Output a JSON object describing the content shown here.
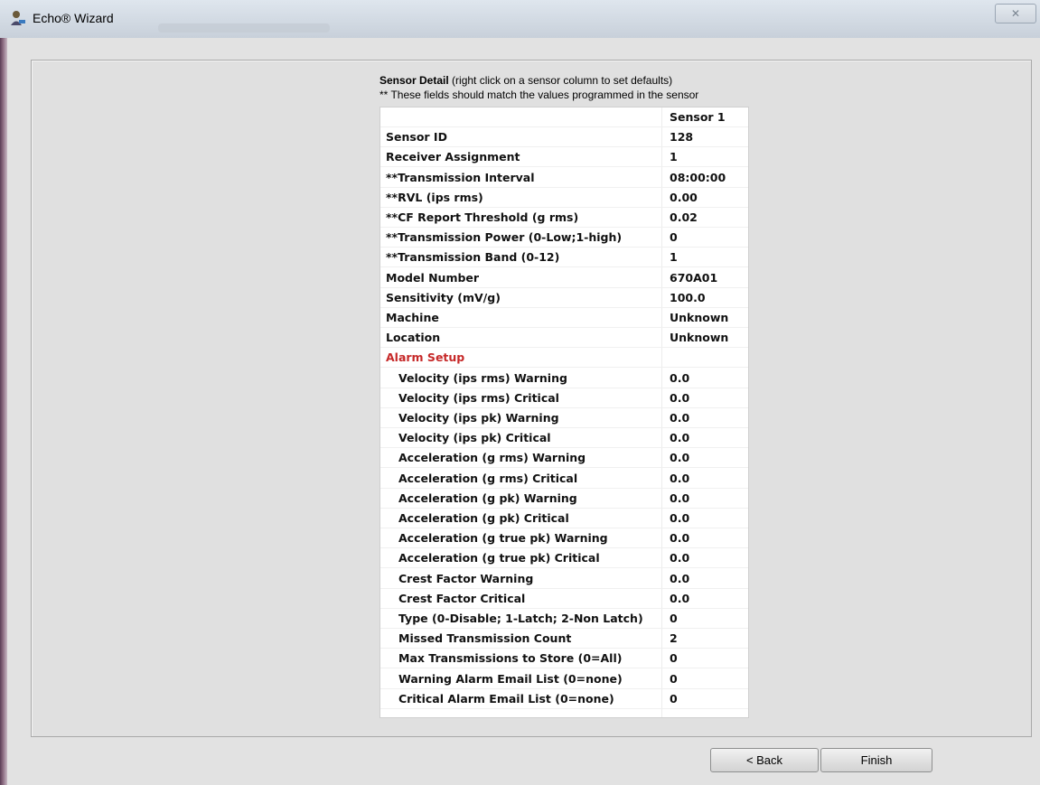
{
  "window": {
    "title": "Echo® Wizard",
    "close_glyph": "✕"
  },
  "header": {
    "title_bold": "Sensor Detail",
    "title_rest": " (right click on a sensor column to set defaults)",
    "note": "** These fields should match the values programmed in the sensor"
  },
  "grid": {
    "column_header": "Sensor 1",
    "rows": [
      {
        "label": "Sensor ID",
        "value": "128"
      },
      {
        "label": "Receiver Assignment",
        "value": "1"
      },
      {
        "label": "**Transmission Interval",
        "value": "08:00:00"
      },
      {
        "label": "**RVL (ips rms)",
        "value": "0.00"
      },
      {
        "label": "**CF Report Threshold (g rms)",
        "value": "0.02"
      },
      {
        "label": "**Transmission Power (0-Low;1-high)",
        "value": "0"
      },
      {
        "label": "**Transmission Band (0-12)",
        "value": "1"
      },
      {
        "label": "Model Number",
        "value": "670A01"
      },
      {
        "label": "Sensitivity (mV/g)",
        "value": "100.0"
      },
      {
        "label": "Machine",
        "value": "Unknown"
      },
      {
        "label": "Location",
        "value": "Unknown"
      },
      {
        "label": "Alarm Setup",
        "value": ""
      },
      {
        "label": "Velocity (ips rms) Warning",
        "value": "0.0"
      },
      {
        "label": "Velocity (ips rms) Critical",
        "value": "0.0"
      },
      {
        "label": "Velocity (ips pk) Warning",
        "value": "0.0"
      },
      {
        "label": "Velocity (ips pk) Critical",
        "value": "0.0"
      },
      {
        "label": "Acceleration (g rms) Warning",
        "value": "0.0"
      },
      {
        "label": "Acceleration (g rms) Critical",
        "value": "0.0"
      },
      {
        "label": "Acceleration (g pk) Warning",
        "value": "0.0"
      },
      {
        "label": "Acceleration (g pk) Critical",
        "value": "0.0"
      },
      {
        "label": "Acceleration (g true pk) Warning",
        "value": "0.0"
      },
      {
        "label": "Acceleration (g true pk) Critical",
        "value": "0.0"
      },
      {
        "label": "Crest Factor Warning",
        "value": "0.0"
      },
      {
        "label": "Crest Factor Critical",
        "value": "0.0"
      },
      {
        "label": "Type (0-Disable; 1-Latch; 2-Non Latch)",
        "value": "0"
      },
      {
        "label": "Missed Transmission Count",
        "value": "2"
      },
      {
        "label": "Max Transmissions to Store (0=All)",
        "value": "0"
      },
      {
        "label": "Warning Alarm Email List (0=none)",
        "value": "0"
      },
      {
        "label": "Critical Alarm Email List (0=none)",
        "value": "0"
      }
    ]
  },
  "buttons": {
    "back": "< Back",
    "finish": "Finish"
  }
}
